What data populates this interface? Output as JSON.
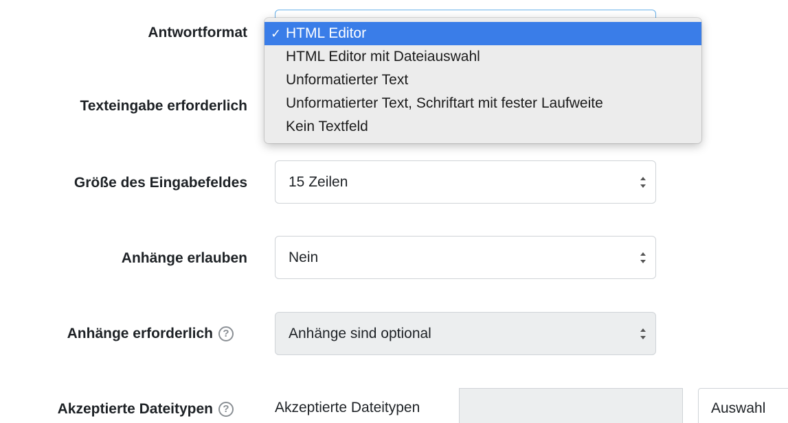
{
  "form": {
    "response_format": {
      "label": "Antwortformat",
      "options": [
        "HTML Editor",
        "HTML Editor mit Dateiauswahl",
        "Unformatierter Text",
        "Unformatierter Text, Schriftart mit fester Laufweite",
        "Kein Textfeld"
      ],
      "selected_index": 0,
      "check_mark": "✓"
    },
    "text_required": {
      "label": "Texteingabe erforderlich"
    },
    "input_size": {
      "label": "Größe des Eingabefeldes",
      "value": "15 Zeilen"
    },
    "allow_attachments": {
      "label": "Anhänge erlauben",
      "value": "Nein"
    },
    "attachments_required": {
      "label": "Anhänge erforderlich",
      "value": "Anhänge sind optional",
      "help_icon": "question-circle-icon",
      "disabled": true
    },
    "accepted_file_types": {
      "label": "Akzeptierte Dateitypen",
      "help_icon": "question-circle-icon",
      "inner_label": "Akzeptierte Dateitypen",
      "input_value": "",
      "button_label": "Auswahl"
    }
  },
  "colors": {
    "highlight": "#3a7de8",
    "disabled_bg": "#eceeef",
    "focus_border": "#66afe9"
  }
}
